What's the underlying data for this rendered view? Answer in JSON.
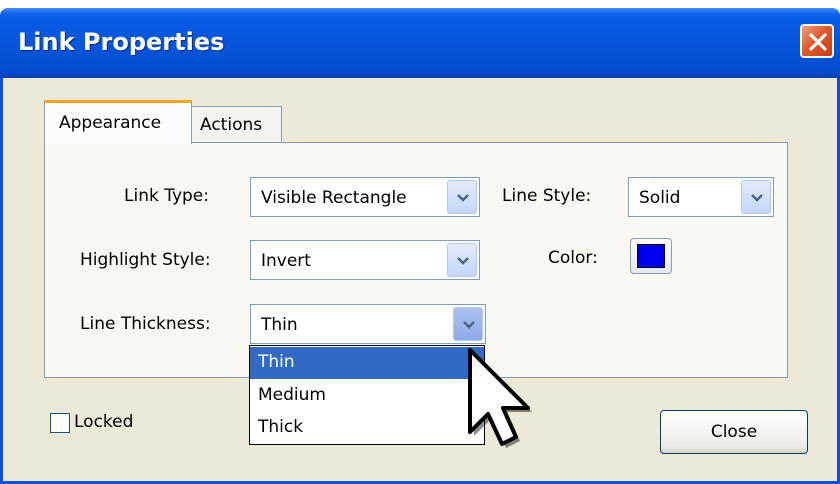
{
  "window": {
    "title": "Link Properties"
  },
  "tabs": [
    {
      "label": "Appearance",
      "active": true
    },
    {
      "label": "Actions",
      "active": false
    }
  ],
  "fields": {
    "link_type": {
      "label": "Link Type:",
      "value": "Visible Rectangle"
    },
    "line_style": {
      "label": "Line Style:",
      "value": "Solid"
    },
    "highlight_style": {
      "label": "Highlight Style:",
      "value": "Invert"
    },
    "color": {
      "label": "Color:",
      "value": "#0000ee"
    },
    "line_thickness": {
      "label": "Line Thickness:",
      "value": "Thin",
      "options": [
        "Thin",
        "Medium",
        "Thick"
      ],
      "selected_option": "Thin"
    }
  },
  "footer": {
    "locked_label": "Locked",
    "locked_checked": false,
    "close_label": "Close"
  },
  "colors": {
    "titlebar": "#0757dd",
    "dialog_bg": "#ece9d8",
    "selection": "#316ac5",
    "tab_accent": "#f5a623"
  },
  "icons": {
    "close": "close-x-icon",
    "dropdown": "chevron-down-icon",
    "cursor": "arrow-cursor-icon"
  }
}
